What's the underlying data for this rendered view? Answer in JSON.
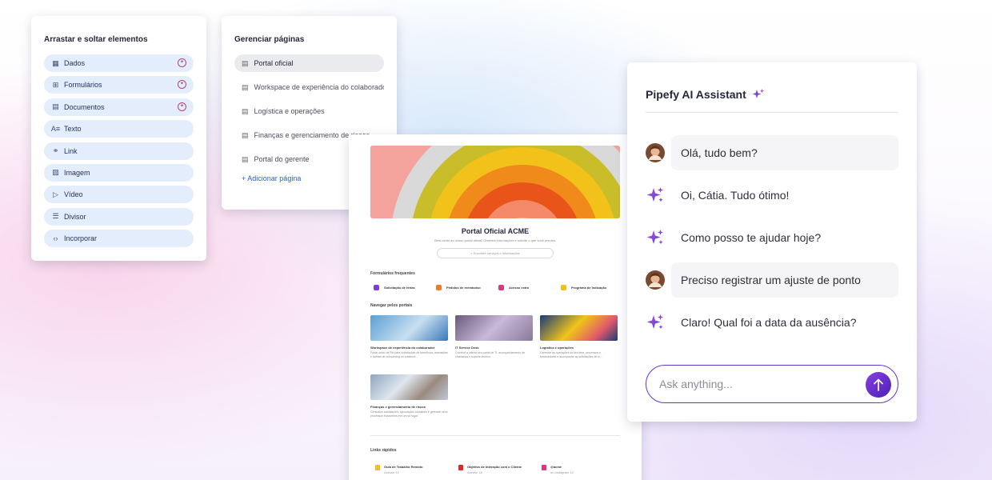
{
  "drag_panel": {
    "title": "Arrastar e soltar elementos",
    "items": [
      {
        "label": "Dados",
        "icon": "table-icon",
        "glyph": "▦",
        "ai": true
      },
      {
        "label": "Formulários",
        "icon": "grid-icon",
        "glyph": "⊞",
        "ai": true
      },
      {
        "label": "Documentos",
        "icon": "document-icon",
        "glyph": "▤",
        "ai": true
      },
      {
        "label": "Texto",
        "icon": "text-icon",
        "glyph": "A≡",
        "ai": false
      },
      {
        "label": "Link",
        "icon": "link-icon",
        "glyph": "⚭",
        "ai": false
      },
      {
        "label": "Imagem",
        "icon": "image-icon",
        "glyph": "▨",
        "ai": false
      },
      {
        "label": "Vídeo",
        "icon": "play-icon",
        "glyph": "▷",
        "ai": false
      },
      {
        "label": "Divisor",
        "icon": "divider-icon",
        "glyph": "☰",
        "ai": false
      },
      {
        "label": "Incorporar",
        "icon": "code-icon",
        "glyph": "‹›",
        "ai": false
      }
    ]
  },
  "pages_panel": {
    "title": "Gerenciar páginas",
    "pages": [
      {
        "label": "Portal oficial",
        "selected": true
      },
      {
        "label": "Workspace de experiência do colaborador",
        "selected": false
      },
      {
        "label": "Logística e operações",
        "selected": false
      },
      {
        "label": "Finanças e gerenciamento de riscos",
        "selected": false
      },
      {
        "label": "Portal do gerente",
        "selected": false
      }
    ],
    "add_label": "Adicionar página"
  },
  "portal": {
    "title": "Portal Oficial ACME",
    "subtitle": "Bem-vindo ao nosso portal oficial! Obtenha informações e solicite o que você precisa.",
    "search_placeholder": "Encontre serviços e informações",
    "forms_title": "Formulários frequentes",
    "forms": [
      {
        "label": "Solicitação de férias",
        "color": "#7b3fe0"
      },
      {
        "label": "Pedidos de reembolso",
        "color": "#f07a2a"
      },
      {
        "label": "Acesso extra",
        "color": "#e0357a"
      },
      {
        "label": "Programa de Indicação",
        "color": "#f2c21a"
      }
    ],
    "browse_title": "Navegar pelos portais",
    "tiles": [
      {
        "title": "Workspace de experiência do colaborador",
        "desc": "Portal único de RH para solicitações de benefícios, admissões e tarefas de onboarding do colabora...",
        "bg": "linear-gradient(135deg,#5aa0d8,#c9dff0 55%,#3a78b8)"
      },
      {
        "title": "IT Service Desk",
        "desc": "Comece a utilizar seu portal de TI, acompanhamento de chamados e suporte técnico.",
        "bg": "linear-gradient(135deg,#6a5a7a,#c9b9d9 50%,#8a7a9a)"
      },
      {
        "title": "Logística e operações",
        "desc": "Gerencie as operações do seu time, processos e fornecedores e acompanhe as solicitações de in...",
        "bg": "linear-gradient(135deg,#1a3a7a,#f0c419 45%,#e05a6a 75%,#1a3a7a)"
      },
      {
        "title": "Finanças e gerenciamento de riscos",
        "desc": "Centralize solicitações, aprovações contábeis e gerencie seus processos financeiros em um só lugar.",
        "bg": "linear-gradient(135deg,#8fa6c0,#dfe6ee 40%,#9a8a80 70%,#c0c9d4)"
      }
    ],
    "links_title": "Links rápidos",
    "links": [
      {
        "title": "Guia de Trabalho Remoto",
        "sub": "Acesse 12",
        "color": "#f2c21a"
      },
      {
        "title": "Objetivo de Interação com o Cliente",
        "sub": "Acesse 18",
        "color": "#e02a2a"
      },
      {
        "title": "@acme",
        "sub": "no Instagram 12",
        "color": "#e0357a"
      }
    ]
  },
  "ai_assistant": {
    "title": "Pipefy AI Assistant",
    "messages": [
      {
        "from": "user",
        "text": "Olá, tudo bem?"
      },
      {
        "from": "ai",
        "text": "Oi, Cátia. Tudo ótimo!"
      },
      {
        "from": "ai",
        "text": "Como posso te ajudar hoje?"
      },
      {
        "from": "user",
        "text": "Preciso registrar um ajuste de ponto"
      },
      {
        "from": "ai",
        "text": "Claro! Qual foi a data da ausência?"
      }
    ],
    "input_placeholder": "Ask anything...",
    "accent": "#6b33c9"
  }
}
